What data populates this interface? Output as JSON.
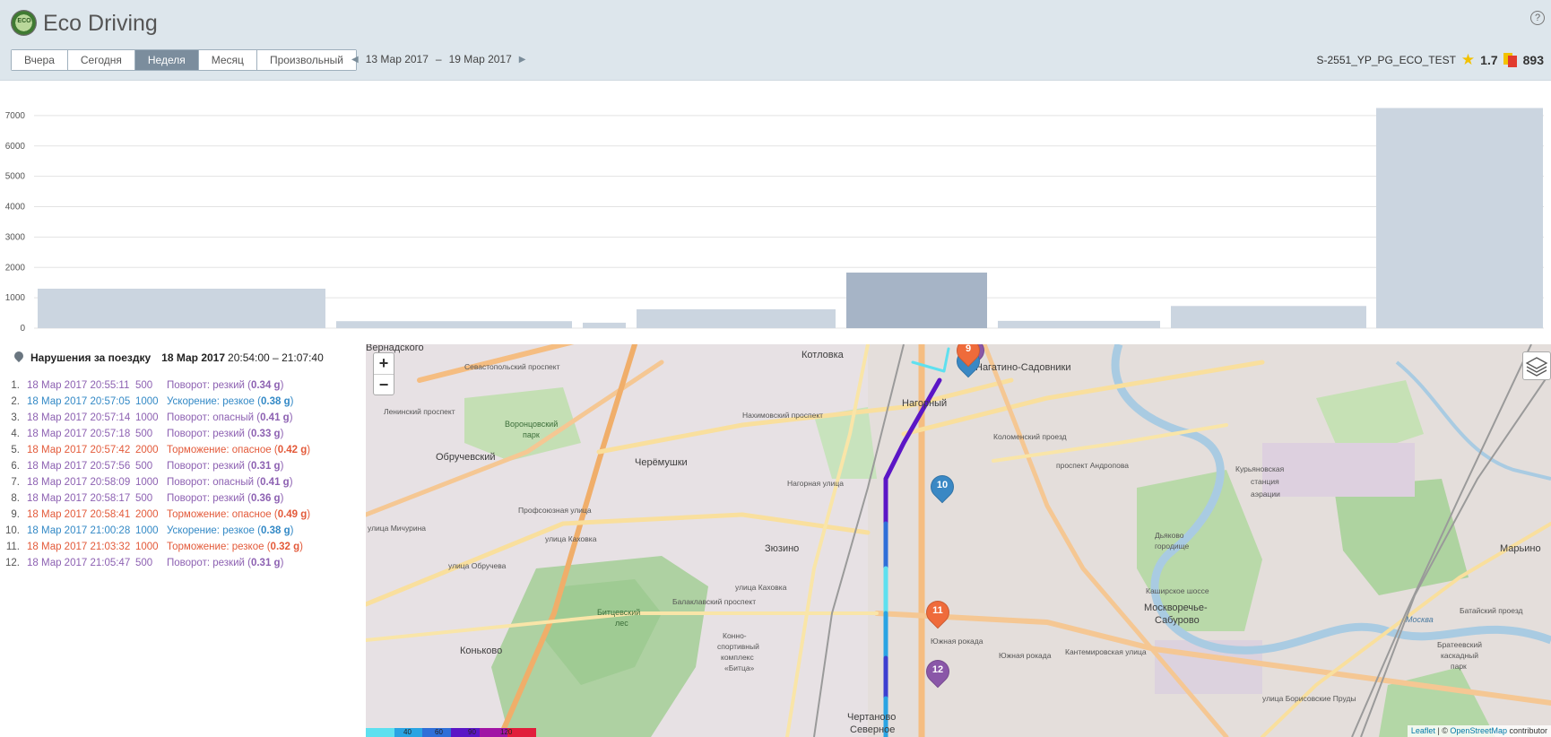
{
  "header": {
    "logo_text": "ECO",
    "title": "Eco Driving",
    "help_label": "?",
    "periods": [
      {
        "label": "Вчера",
        "active": false
      },
      {
        "label": "Сегодня",
        "active": false
      },
      {
        "label": "Неделя",
        "active": true
      },
      {
        "label": "Месяц",
        "active": false
      },
      {
        "label": "Произвольный",
        "active": false
      }
    ],
    "date_from": "13 Мар 2017",
    "date_sep": "–",
    "date_to": "19 Мар 2017",
    "vehicle": "S-2551_YP_PG_ECO_TEST",
    "rating": "1.7",
    "penalty_points": "893"
  },
  "colors": {
    "bar": "#cbd5e0",
    "bar_selected": "#a6b4c6",
    "turn": "#8d61b2",
    "acceleration": "#3389c6",
    "braking": "#e35a3a"
  },
  "chart_data": {
    "type": "bar",
    "ylim": [
      0,
      7500
    ],
    "yticks": [
      "0",
      "1000",
      "2000",
      "3000",
      "4000",
      "5000",
      "6000",
      "7000"
    ],
    "ytick_values": [
      0,
      1000,
      2000,
      3000,
      4000,
      5000,
      6000,
      7000
    ],
    "values": [
      1300,
      230,
      180,
      620,
      1830,
      240,
      730,
      7250
    ],
    "selected_index": 4,
    "grid": true
  },
  "violations": {
    "title": "Нарушения за поездку",
    "date": "18 Мар 2017",
    "times": "20:54:00 – 21:07:40",
    "items": [
      {
        "num": "1.",
        "time": "18 Мар 2017 20:55:11",
        "points": "500",
        "type": "turn",
        "desc": "Поворот: резкий",
        "g": "0.34 g"
      },
      {
        "num": "2.",
        "time": "18 Мар 2017 20:57:05",
        "points": "1000",
        "type": "acc",
        "desc": "Ускорение: резкое",
        "g": "0.38 g"
      },
      {
        "num": "3.",
        "time": "18 Мар 2017 20:57:14",
        "points": "1000",
        "type": "turn",
        "desc": "Поворот: опасный",
        "g": "0.41 g"
      },
      {
        "num": "4.",
        "time": "18 Мар 2017 20:57:18",
        "points": "500",
        "type": "turn",
        "desc": "Поворот: резкий",
        "g": "0.33 g"
      },
      {
        "num": "5.",
        "time": "18 Мар 2017 20:57:42",
        "points": "2000",
        "type": "brake",
        "desc": "Торможение: опасное",
        "g": "0.42 g"
      },
      {
        "num": "6.",
        "time": "18 Мар 2017 20:57:56",
        "points": "500",
        "type": "turn",
        "desc": "Поворот: резкий",
        "g": "0.31 g"
      },
      {
        "num": "7.",
        "time": "18 Мар 2017 20:58:09",
        "points": "1000",
        "type": "turn",
        "desc": "Поворот: опасный",
        "g": "0.41 g"
      },
      {
        "num": "8.",
        "time": "18 Мар 2017 20:58:17",
        "points": "500",
        "type": "turn",
        "desc": "Поворот: резкий",
        "g": "0.36 g"
      },
      {
        "num": "9.",
        "time": "18 Мар 2017 20:58:41",
        "points": "2000",
        "type": "brake",
        "desc": "Торможение: опасное",
        "g": "0.49 g"
      },
      {
        "num": "10.",
        "time": "18 Мар 2017 21:00:28",
        "points": "1000",
        "type": "acc",
        "desc": "Ускорение: резкое",
        "g": "0.38 g"
      },
      {
        "num": "11.",
        "time": "18 Мар 2017 21:03:32",
        "points": "1000",
        "type": "brake",
        "desc": "Торможение: резкое",
        "g": "0.32 g"
      },
      {
        "num": "12.",
        "time": "18 Мар 2017 21:05:47",
        "points": "500",
        "type": "turn",
        "desc": "Поворот: резкий",
        "g": "0.31 g"
      }
    ]
  },
  "map": {
    "zoom_in": "+",
    "zoom_out": "−",
    "labels": {
      "vernadsky": "Вернадского",
      "kotlovka": "Котловка",
      "nagatino": "Нагатино-Садовники",
      "nagorny": "Нагорный",
      "obruchevsky": "Обручевский",
      "cheremushki": "Черёмушки",
      "zyuzino": "Зюзино",
      "kurianovskaya1": "Курьяновская",
      "kurianovskaya2": "станция",
      "kurianovskaya3": "аэрации",
      "marino": "Марьино",
      "dyakovo1": "Дьяково",
      "dyakovo2": "городище",
      "moskvorechye1": "Москворечье-",
      "moskvorechye2": "Сабурово",
      "konkovo": "Коньково",
      "chertanovo1": "Чертаново",
      "chertanovo2": "Северное",
      "vorontsovsky1": "Воронцовский",
      "vorontsovsky2": "парк",
      "bitsevsky1": "Битцевский",
      "bitsevsky2": "лес",
      "kashirskoe": "Каширское шоссе",
      "kolomensky": "Коломенский проезд",
      "kakhovka1": "улица Каховка",
      "kakhovka2": "улица Каховка",
      "obrucheva": "улица Обручева",
      "balaklavsky": "Балаклавский проспект",
      "yuzhnaya1": "Южная рокада",
      "yuzhnaya2": "Южная рокада",
      "nakhimovsky": "Нахимовский проспект",
      "kantemirovskaya": "Кантемировская улица",
      "moskva": "Москва",
      "bratsevsky1": "Братеевский",
      "bratsevsky2": "каскадный",
      "bratsevsky3": "парк",
      "batayskiy": "Батайский проезд",
      "borisovskie": "улица Борисовские Пруды",
      "konno1": "Конно-",
      "konno2": "спортивный",
      "konno3": "комплекс",
      "konno4": "«Битца»",
      "sevastopolsky": "Севастопольский проспект",
      "profsoyuznaya": "Профсоюзная улица",
      "leninsky": "Ленинский проспект",
      "andropova": "проспект Андропова",
      "nagornaya": "Нагорная улица",
      "elistinskaya": "улица Мичурина"
    },
    "markers": [
      {
        "num": "9",
        "color": "#ef6b3b"
      },
      {
        "num": "10",
        "color": "#3a88c4"
      },
      {
        "num": "11",
        "color": "#ef6b3b"
      },
      {
        "num": "12",
        "color": "#8a57a8"
      }
    ],
    "legend_labels": [
      "40",
      "60",
      "90",
      "120"
    ],
    "legend_colors": [
      "#5ee0ef",
      "#2aa4e3",
      "#2f6fd8",
      "#5b16c6",
      "#a114a5",
      "#e11e3b"
    ],
    "attribution_leaflet": "Leaflet",
    "attribution_sep": " | © ",
    "attribution_osm": "OpenStreetMap",
    "attribution_rest": " contributor"
  }
}
